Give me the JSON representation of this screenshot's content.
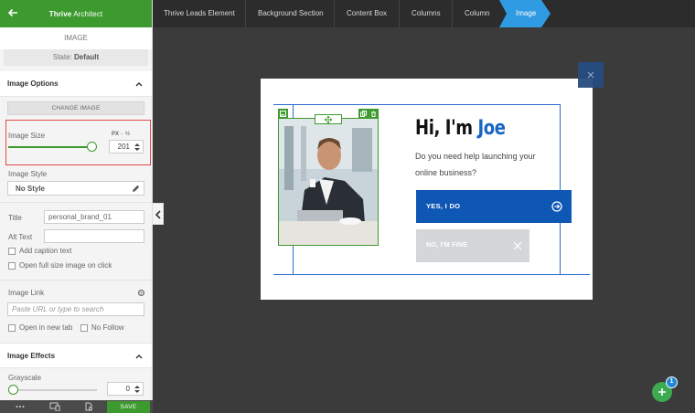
{
  "sidebar": {
    "brand_bold": "Thrive",
    "brand_light": " Architect",
    "element_name": "IMAGE",
    "state_label": "State:",
    "state_value": "Default",
    "image_options": {
      "title": "Image Options",
      "change_image_label": "CHANGE IMAGE",
      "image_size_label": "Image Size",
      "unit_px": "PX",
      "unit_sep": "-",
      "unit_pct": "%",
      "image_size_value": "201",
      "image_size_fraction": 0.55,
      "image_style_label": "Image Style",
      "image_style_value": "No Style",
      "title_label": "Title",
      "title_value": "personal_brand_01",
      "alt_label": "Alt Text",
      "alt_value": "",
      "add_caption_label": "Add caption text",
      "open_full_label": "Open full size image on click",
      "image_link_label": "Image Link",
      "image_link_placeholder": "Paste URL or type to search",
      "new_tab_label": "Open in new tab",
      "no_follow_label": "No Follow"
    },
    "image_effects": {
      "title": "Image Effects",
      "grayscale_label": "Grayscale",
      "grayscale_value": "0"
    },
    "footer": {
      "more_icon": "more-dots-icon",
      "responsive_icon": "responsive-devices-icon",
      "settings_icon": "page-settings-icon",
      "save_label": "SAVE"
    }
  },
  "breadcrumbs": [
    "Thrive Leads Element",
    "Background Section",
    "Content Box",
    "Columns",
    "Column",
    "Image"
  ],
  "canvas": {
    "heading_prefix": "Hi, I'm ",
    "heading_name": "Joe",
    "body_line1": "Do you need help launching your",
    "body_line2": "online business?",
    "yes_button": "YES, I DO",
    "no_button": "NO, I'M FINE"
  },
  "fab": {
    "badge_count": "1"
  },
  "colors": {
    "accent_green": "#3d9a2e",
    "primary_blue": "#0f57b4",
    "breadcrumb_active": "#2e9be3",
    "highlight_red": "#e04b4b"
  }
}
